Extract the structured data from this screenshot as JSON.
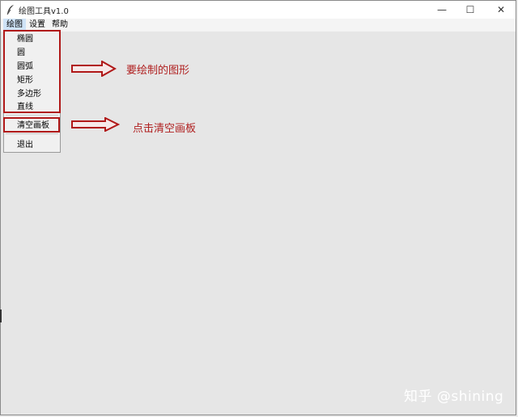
{
  "window": {
    "title": "绘图工具v1.0",
    "controls": {
      "minimize": "—",
      "maximize": "☐",
      "close": "✕"
    }
  },
  "menubar": {
    "items": [
      "绘图",
      "设置",
      "帮助"
    ]
  },
  "dropdown": {
    "items": [
      "椭圆",
      "圆",
      "圆弧",
      "矩形",
      "多边形",
      "直线"
    ],
    "clear": "清空画板",
    "exit": "退出"
  },
  "annotations": {
    "shapes": "要绘制的图形",
    "clear": "点击清空画板",
    "color": "#b02020"
  },
  "watermark": "知乎 @shining"
}
